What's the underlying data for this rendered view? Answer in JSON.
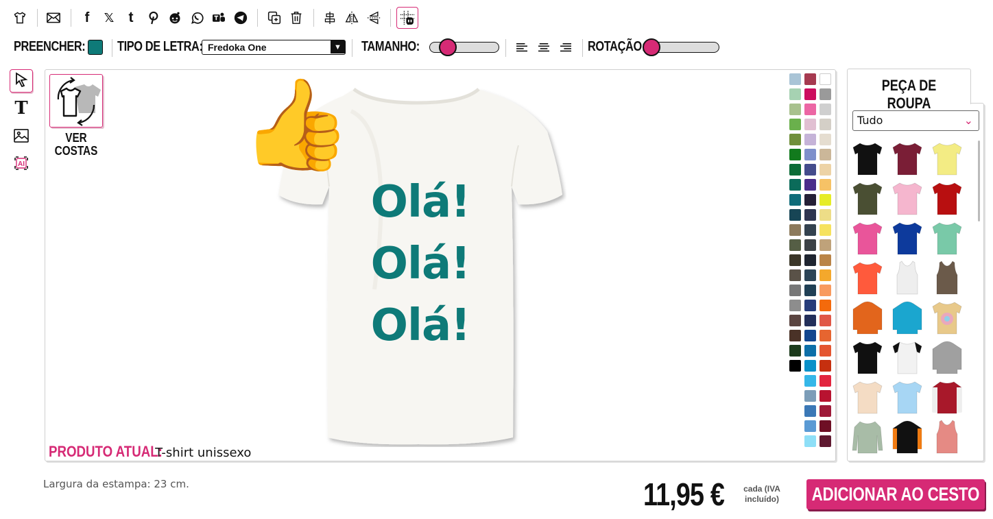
{
  "toolbar": {
    "icons": [
      "tshirt-icon",
      "email-icon",
      "facebook-icon",
      "x-icon",
      "tumblr-icon",
      "pinterest-icon",
      "reddit-icon",
      "whatsapp-icon",
      "teams-icon",
      "telegram-icon",
      "duplicate-icon",
      "trash-icon",
      "align-center-icon",
      "flip-horizontal-icon",
      "flip-vertical-icon",
      "grid-snap-icon"
    ],
    "social_glyphs": {
      "facebook": "f",
      "x": "𝕏",
      "tumblr": "t"
    }
  },
  "options_bar": {
    "fill_label": "PREENCHER:",
    "fill_color": "#0e7a78",
    "font_label": "TIPO DE LETRA:",
    "font_value": "Fredoka One",
    "size_label": "TAMANHO:",
    "rotation_label": "ROTAÇÃO:",
    "size_level": 0.25,
    "rotation_level": 0.1
  },
  "tools": [
    "select-tool",
    "text-tool",
    "image-tool",
    "ai-tool"
  ],
  "canvas": {
    "back_label_1": "VER",
    "back_label_2": "COSTAS",
    "design_lines": [
      "Olá!",
      "Olá!",
      "Olá!"
    ],
    "product_label": "PRODUTO ATUAL:",
    "product_value": "T-shirt unissexo",
    "design_color": "#0e7a78",
    "emoji": "👍"
  },
  "palette": {
    "col1": [
      "#a9c4d6",
      "#a6d2b2",
      "#a8c18e",
      "#6ab04c",
      "#6f8f3a",
      "#127a1d",
      "#0b6b36",
      "#0b6b5a",
      "#106c79",
      "#174555",
      "#8c7a5c",
      "#555e45",
      "#3a3628",
      "#5a5248",
      "#777777",
      "#8d8d8d",
      "#5a4440",
      "#4a3227",
      "#1c3b1c",
      "#000000"
    ],
    "col2": [
      "#a63a50",
      "#cc0d5e",
      "#ec66a4",
      "#e1bfd2",
      "#c5b3d8",
      "#7e8fcb",
      "#444c8c",
      "#4a2c8a",
      "#252036",
      "#2e3550",
      "#34424f",
      "#3b4146",
      "#1f2530",
      "#2c4456",
      "#204055",
      "#263c7a",
      "#232f5a",
      "#12468f",
      "#0d6fa8",
      "#0a91c9",
      "#35b7e8",
      "#7c9db8",
      "#3b78b6",
      "#5a9ad4",
      "#8edff7"
    ],
    "col3": [
      "#ffffff",
      "#9a9a9a",
      "#cfcfcf",
      "#d4cfc7",
      "#e5ddd0",
      "#cbb799",
      "#edd3a6",
      "#f6c266",
      "#e6ec26",
      "#eddd87",
      "#f6e25e",
      "#bfa27a",
      "#ba8447",
      "#f4a82c",
      "#f89a5e",
      "#f46a0c",
      "#e05746",
      "#e66530",
      "#e45530",
      "#c6300f",
      "#e2253f",
      "#b81330",
      "#9e1a39",
      "#6e0f25",
      "#5f1a31"
    ]
  },
  "panel": {
    "tab_label": "PEÇA DE ROUPA",
    "filter_value": "Tudo",
    "products": [
      {
        "name": "black-tee",
        "color": "#111111",
        "type": "tee"
      },
      {
        "name": "maroon-tee",
        "color": "#7a1e36",
        "type": "tee"
      },
      {
        "name": "yellow-tee",
        "color": "#f3ec84",
        "type": "tee"
      },
      {
        "name": "olive-tee",
        "color": "#4a4f33",
        "type": "tee"
      },
      {
        "name": "pink-tee",
        "color": "#f5b6ce",
        "type": "tee"
      },
      {
        "name": "red-tee",
        "color": "#b80f10",
        "type": "tee"
      },
      {
        "name": "fuchsia-tee",
        "color": "#e9559a",
        "type": "tee"
      },
      {
        "name": "royal-tee",
        "color": "#0d3a9c",
        "type": "tee"
      },
      {
        "name": "mint-tee",
        "color": "#79c9a8",
        "type": "tee"
      },
      {
        "name": "coral-tee",
        "color": "#ff5a3c",
        "type": "tee"
      },
      {
        "name": "white-tank",
        "color": "#eeeeee",
        "type": "tank"
      },
      {
        "name": "brown-tank",
        "color": "#6b5a4a",
        "type": "tank"
      },
      {
        "name": "orange-hoodie",
        "color": "#e2651c",
        "type": "hoodie"
      },
      {
        "name": "turquoise-hoodie",
        "color": "#1ba6cf",
        "type": "hoodie"
      },
      {
        "name": "tiedye-tee",
        "color": "#e8c98a",
        "type": "tee"
      },
      {
        "name": "black-tee-2",
        "color": "#101010",
        "type": "tee"
      },
      {
        "name": "raglan-tee",
        "color": "#f2f2f2",
        "type": "raglan"
      },
      {
        "name": "grey-hoodie",
        "color": "#a0a0a0",
        "type": "hoodie"
      },
      {
        "name": "natural-tee",
        "color": "#f4dcc4",
        "type": "tee"
      },
      {
        "name": "skyblue-tee",
        "color": "#a7d6f4",
        "type": "tee"
      },
      {
        "name": "varsity-jacket",
        "color": "#a8182a",
        "type": "jacket"
      },
      {
        "name": "sage-longsleeve",
        "color": "#a8bca7",
        "type": "longsleeve"
      },
      {
        "name": "black-orange-hoodie",
        "color": "#111111",
        "type": "hoodie"
      },
      {
        "name": "rose-tank",
        "color": "#e58a84",
        "type": "tank"
      }
    ]
  },
  "footer": {
    "print_width": "Largura da estampa: 23 cm.",
    "price": "11,95 €",
    "price_note_1": "cada (IVA",
    "price_note_2": "incluído)",
    "add_button": "ADICIONAR AO CESTO"
  }
}
